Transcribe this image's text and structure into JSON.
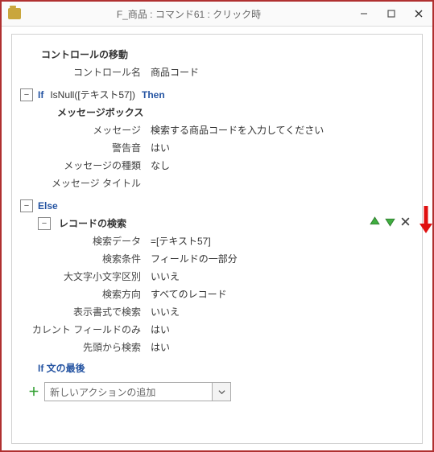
{
  "window": {
    "title": "F_商品 : コマンド61 : クリック時"
  },
  "block1": {
    "title": "コントロールの移動",
    "r1_label": "コントロール名",
    "r1_value": "商品コード"
  },
  "ifLine": {
    "kw_if": "If",
    "cond": "IsNull([テキスト57])",
    "kw_then": "Then"
  },
  "msgbox": {
    "title": "メッセージボックス",
    "r1_label": "メッセージ",
    "r1_value": "検索する商品コードを入力してください",
    "r2_label": "警告音",
    "r2_value": "はい",
    "r3_label": "メッセージの種類",
    "r3_value": "なし",
    "r4_label": "メッセージ タイトル",
    "r4_value": ""
  },
  "elseLine": {
    "kw": "Else"
  },
  "find": {
    "title": "レコードの検索",
    "r1_label": "検索データ",
    "r1_value": "=[テキスト57]",
    "r2_label": "検索条件",
    "r2_value": "フィールドの一部分",
    "r3_label": "大文字小文字区別",
    "r3_value": "いいえ",
    "r4_label": "検索方向",
    "r4_value": "すべてのレコード",
    "r5_label": "表示書式で検索",
    "r5_value": "いいえ",
    "r6_label": "カレント フィールドのみ",
    "r6_value": "はい",
    "r7_label": "先頭から検索",
    "r7_value": "はい"
  },
  "endif": {
    "label": "If 文の最後"
  },
  "addAction": {
    "placeholder": "新しいアクションの追加"
  },
  "icons": {
    "up": "move-up-icon",
    "down": "move-down-icon",
    "del": "delete-icon"
  }
}
